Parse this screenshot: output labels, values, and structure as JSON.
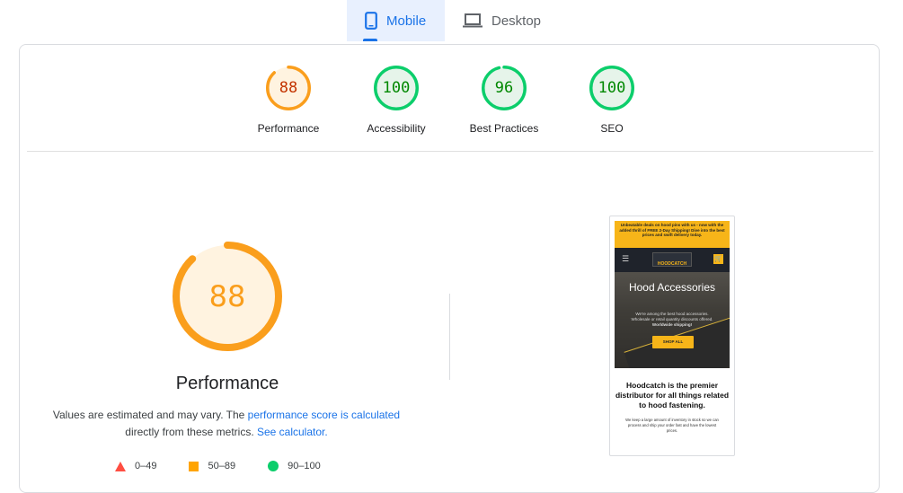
{
  "tabs": {
    "mobile": {
      "label": "Mobile",
      "icon": "smartphone-icon",
      "active": true
    },
    "desktop": {
      "label": "Desktop",
      "icon": "laptop-icon",
      "active": false
    }
  },
  "colors": {
    "accent_blue": "#1a73e8",
    "average": "#fa9e1c",
    "average_fill": "#fff3e0",
    "pass": "#0cce6b",
    "pass_fill": "#e6f4ea",
    "pass_text": "#008800",
    "fail": "#ff4e42"
  },
  "scores": [
    {
      "label": "Performance",
      "value": "88",
      "fraction": 0.88,
      "status": "average"
    },
    {
      "label": "Accessibility",
      "value": "100",
      "fraction": 1.0,
      "status": "pass"
    },
    {
      "label": "Best Practices",
      "value": "96",
      "fraction": 0.96,
      "status": "pass"
    },
    {
      "label": "SEO",
      "value": "100",
      "fraction": 1.0,
      "status": "pass"
    }
  ],
  "main_gauge": {
    "value": "88",
    "fraction": 0.88,
    "title": "Performance"
  },
  "description": {
    "part1": "Values are estimated and may vary. The ",
    "link1": "performance score is calculated",
    "part2": " directly from these metrics. ",
    "link2": "See calculator.",
    "part3": ""
  },
  "legend": [
    {
      "range": "0–49",
      "shape": "triangle"
    },
    {
      "range": "50–89",
      "shape": "square"
    },
    {
      "range": "90–100",
      "shape": "circle"
    }
  ],
  "screenshot": {
    "promo": "Unbeatable deals on hood pins with us - now with the added thrill of FREE 2-Day Shipping! Dive into the best prices and swift delivery today.",
    "logo": "HOODCATCH",
    "hero_title": "Hood Accessories",
    "hero_sub1": "We're among the best hood accessories.",
    "hero_sub2": "Wholesale or retail quantity discounts offered.",
    "hero_sub3": "Worldwide shipping!",
    "shop_button": "SHOP ALL",
    "about_heading": "Hoodcatch is the premier distributor for all things related to hood fastening.",
    "about_text": "We keep a large amount of inventory in stock so we can process and ship your order fast and have the lowest prices."
  }
}
